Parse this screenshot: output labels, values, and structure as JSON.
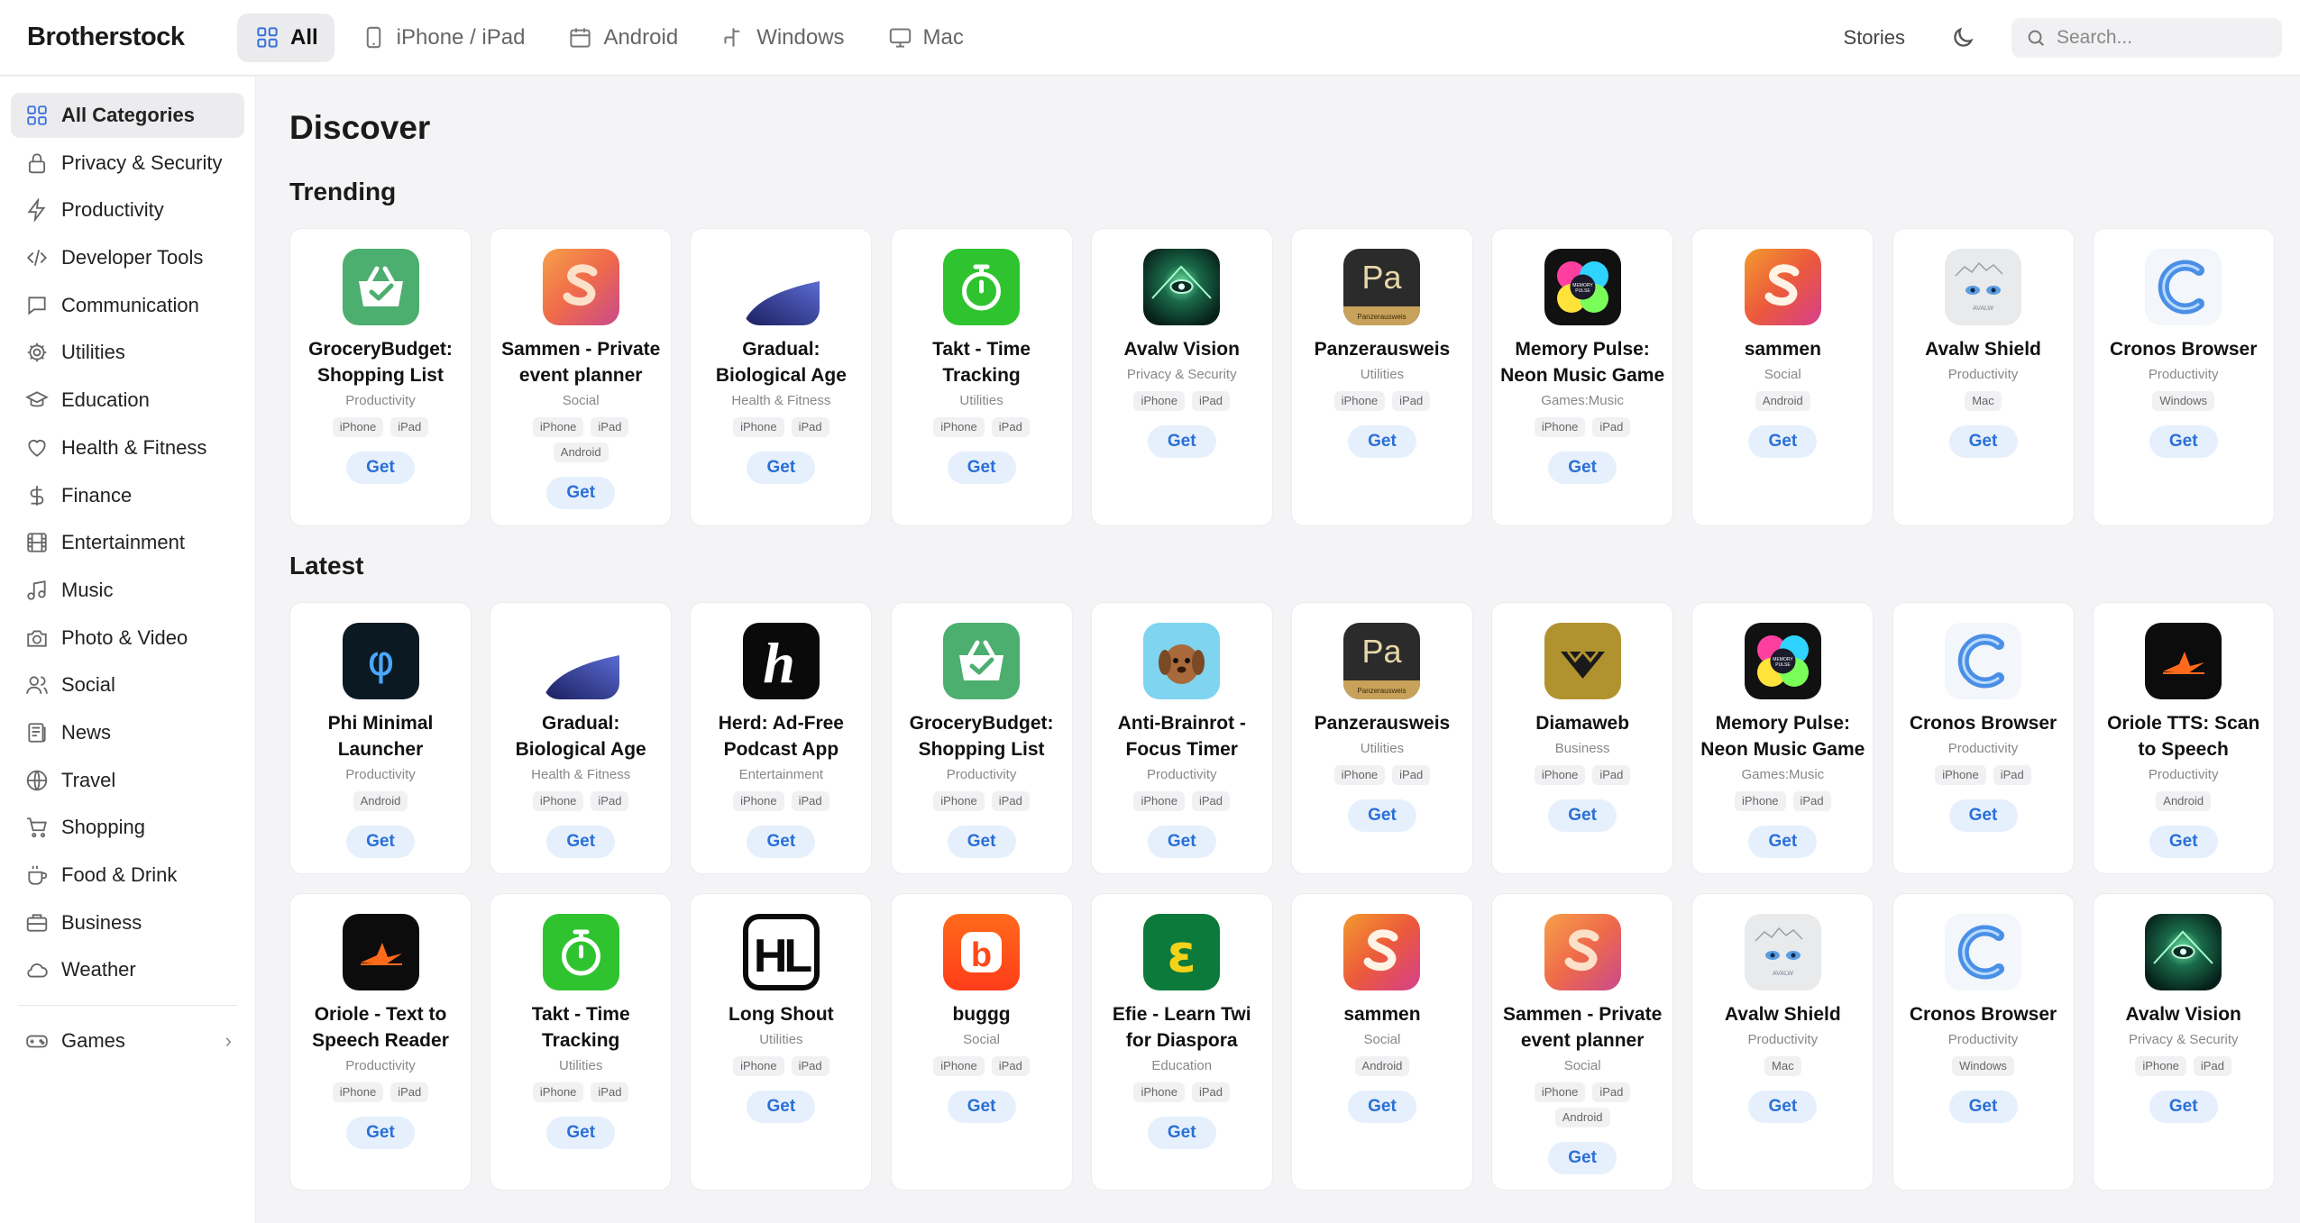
{
  "header": {
    "brand": "Brotherstock",
    "tabs": [
      {
        "label": "All",
        "icon": "grid-icon",
        "active": true
      },
      {
        "label": "iPhone / iPad",
        "icon": "phone-icon"
      },
      {
        "label": "Android",
        "icon": "calendar-icon"
      },
      {
        "label": "Windows",
        "icon": "windows-icon"
      },
      {
        "label": "Mac",
        "icon": "monitor-icon"
      }
    ],
    "stories": "Stories",
    "theme_icon": "moon-icon",
    "search_placeholder": "Search..."
  },
  "sidebar": {
    "categories": [
      {
        "label": "All Categories",
        "icon": "grid-icon",
        "active": true
      },
      {
        "label": "Privacy & Security",
        "icon": "lock-icon"
      },
      {
        "label": "Productivity",
        "icon": "lightning-icon"
      },
      {
        "label": "Developer Tools",
        "icon": "code-icon"
      },
      {
        "label": "Communication",
        "icon": "chat-icon"
      },
      {
        "label": "Utilities",
        "icon": "gear-icon"
      },
      {
        "label": "Education",
        "icon": "graduation-cap-icon"
      },
      {
        "label": "Health & Fitness",
        "icon": "heart-icon"
      },
      {
        "label": "Finance",
        "icon": "dollar-icon"
      },
      {
        "label": "Entertainment",
        "icon": "film-icon"
      },
      {
        "label": "Music",
        "icon": "music-icon"
      },
      {
        "label": "Photo & Video",
        "icon": "camera-icon"
      },
      {
        "label": "Social",
        "icon": "users-icon"
      },
      {
        "label": "News",
        "icon": "newspaper-icon"
      },
      {
        "label": "Travel",
        "icon": "globe-icon"
      },
      {
        "label": "Shopping",
        "icon": "cart-icon"
      },
      {
        "label": "Food & Drink",
        "icon": "coffee-icon"
      },
      {
        "label": "Business",
        "icon": "briefcase-icon"
      },
      {
        "label": "Weather",
        "icon": "cloud-icon"
      }
    ],
    "games": {
      "label": "Games",
      "icon": "gamepad-icon",
      "chevron": "›"
    }
  },
  "main": {
    "title": "Discover",
    "trending_title": "Trending",
    "latest_title": "Latest",
    "get_label": "Get",
    "trending": [
      {
        "name": "GroceryBudget: Shopping List",
        "category": "Productivity",
        "platforms": [
          "iPhone",
          "iPad"
        ],
        "icon": "grocery"
      },
      {
        "name": "Sammen - Private event planner",
        "category": "Social",
        "platforms": [
          "iPhone",
          "iPad",
          "Android"
        ],
        "icon": "sammen-orange"
      },
      {
        "name": "Gradual: Biological Age",
        "category": "Health & Fitness",
        "platforms": [
          "iPhone",
          "iPad"
        ],
        "icon": "gradual"
      },
      {
        "name": "Takt - Time Tracking",
        "category": "Utilities",
        "platforms": [
          "iPhone",
          "iPad"
        ],
        "icon": "takt"
      },
      {
        "name": "Avalw Vision",
        "category": "Privacy & Security",
        "platforms": [
          "iPhone",
          "iPad"
        ],
        "icon": "vision"
      },
      {
        "name": "Panzerausweis",
        "category": "Utilities",
        "platforms": [
          "iPhone",
          "iPad"
        ],
        "icon": "panzer"
      },
      {
        "name": "Memory Pulse: Neon Music Game",
        "category": "Games:Music",
        "platforms": [
          "iPhone",
          "iPad"
        ],
        "icon": "memory"
      },
      {
        "name": "sammen",
        "category": "Social",
        "platforms": [
          "Android"
        ],
        "icon": "sammen-pink"
      },
      {
        "name": "Avalw Shield",
        "category": "Productivity",
        "platforms": [
          "Mac"
        ],
        "icon": "shield"
      },
      {
        "name": "Cronos Browser",
        "category": "Productivity",
        "platforms": [
          "Windows"
        ],
        "icon": "cronos"
      }
    ],
    "latest": [
      {
        "name": "Phi Minimal Launcher",
        "category": "Productivity",
        "platforms": [
          "Android"
        ],
        "icon": "phi"
      },
      {
        "name": "Gradual: Biological Age",
        "category": "Health & Fitness",
        "platforms": [
          "iPhone",
          "iPad"
        ],
        "icon": "gradual"
      },
      {
        "name": "Herd: Ad-Free Podcast App",
        "category": "Entertainment",
        "platforms": [
          "iPhone",
          "iPad"
        ],
        "icon": "herd"
      },
      {
        "name": "GroceryBudget: Shopping List",
        "category": "Productivity",
        "platforms": [
          "iPhone",
          "iPad"
        ],
        "icon": "grocery"
      },
      {
        "name": "Anti-Brainrot - Focus Timer",
        "category": "Productivity",
        "platforms": [
          "iPhone",
          "iPad"
        ],
        "icon": "brainrot"
      },
      {
        "name": "Panzerausweis",
        "category": "Utilities",
        "platforms": [
          "iPhone",
          "iPad"
        ],
        "icon": "panzer"
      },
      {
        "name": "Diamaweb",
        "category": "Business",
        "platforms": [
          "iPhone",
          "iPad"
        ],
        "icon": "diamaweb"
      },
      {
        "name": "Memory Pulse: Neon Music Game",
        "category": "Games:Music",
        "platforms": [
          "iPhone",
          "iPad"
        ],
        "icon": "memory"
      },
      {
        "name": "Cronos Browser",
        "category": "Productivity",
        "platforms": [
          "iPhone",
          "iPad"
        ],
        "icon": "cronos"
      },
      {
        "name": "Oriole TTS: Scan to Speech",
        "category": "Productivity",
        "platforms": [
          "Android"
        ],
        "icon": "oriole"
      },
      {
        "name": "Oriole - Text to Speech Reader",
        "category": "Productivity",
        "platforms": [
          "iPhone",
          "iPad"
        ],
        "icon": "oriole"
      },
      {
        "name": "Takt - Time Tracking",
        "category": "Utilities",
        "platforms": [
          "iPhone",
          "iPad"
        ],
        "icon": "takt"
      },
      {
        "name": "Long Shout",
        "category": "Utilities",
        "platforms": [
          "iPhone",
          "iPad"
        ],
        "icon": "longshout"
      },
      {
        "name": "buggg",
        "category": "Social",
        "platforms": [
          "iPhone",
          "iPad"
        ],
        "icon": "buggg"
      },
      {
        "name": "Efie - Learn Twi for Diaspora",
        "category": "Education",
        "platforms": [
          "iPhone",
          "iPad"
        ],
        "icon": "efie"
      },
      {
        "name": "sammen",
        "category": "Social",
        "platforms": [
          "Android"
        ],
        "icon": "sammen-pink"
      },
      {
        "name": "Sammen - Private event planner",
        "category": "Social",
        "platforms": [
          "iPhone",
          "iPad",
          "Android"
        ],
        "icon": "sammen-orange"
      },
      {
        "name": "Avalw Shield",
        "category": "Productivity",
        "platforms": [
          "Mac"
        ],
        "icon": "shield"
      },
      {
        "name": "Cronos Browser",
        "category": "Productivity",
        "platforms": [
          "Windows"
        ],
        "icon": "cronos"
      },
      {
        "name": "Avalw Vision",
        "category": "Privacy & Security",
        "platforms": [
          "iPhone",
          "iPad"
        ],
        "icon": "vision"
      }
    ],
    "icon_text": {
      "panzer": "Pa",
      "panzer_small": "Panzerausweis",
      "memory_small": "MEMORY PULSE",
      "phi": "φ",
      "herd": "h",
      "longshout": "HL",
      "buggg": "b",
      "efie": "ε",
      "avalw": "AVALW"
    },
    "colors": {
      "accent": "#3a6fd8",
      "get_text": "#2b6fd6",
      "get_bg": "#e6f0fc"
    }
  }
}
